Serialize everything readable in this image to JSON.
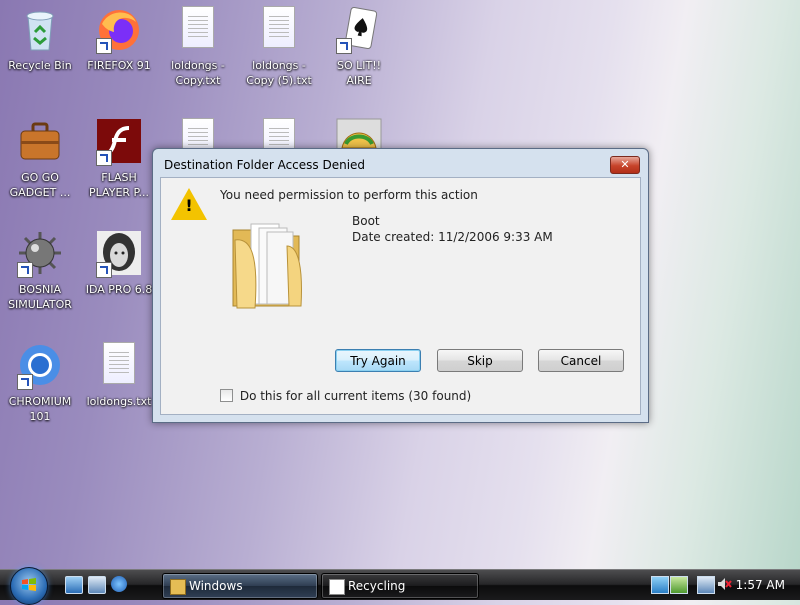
{
  "desktop": {
    "icons": [
      {
        "label": "Recycle Bin",
        "icon": "recycle-bin-icon"
      },
      {
        "label": "FIREFOX 91",
        "icon": "firefox-icon"
      },
      {
        "label": "loldongs - Copy.txt",
        "icon": "text-file-icon"
      },
      {
        "label": "loldongs - Copy (5).txt",
        "icon": "text-file-icon"
      },
      {
        "label": "SO LIT!! AIRE",
        "icon": "solitaire-icon"
      },
      {
        "label": "GO GO GADGET ...",
        "icon": "briefcase-icon"
      },
      {
        "label": "FLASH PLAYER P...",
        "icon": "flash-player-icon"
      },
      {
        "label": "BOSNIA SIMULATOR",
        "icon": "mine-icon"
      },
      {
        "label": "IDA PRO 6.8",
        "icon": "ida-pro-icon"
      },
      {
        "label": "CHROMIUM 101",
        "icon": "chromium-icon"
      },
      {
        "label": "loldongs.txt",
        "icon": "text-file-icon"
      }
    ]
  },
  "dialog": {
    "title": "Destination Folder Access Denied",
    "close_icon": "close-icon",
    "message": "You need permission to perform this action",
    "item_name": "Boot",
    "item_date": "Date created: 11/2/2006 9:33 AM",
    "buttons": {
      "try_again": "Try Again",
      "skip": "Skip",
      "cancel": "Cancel"
    },
    "checkbox_label": "Do this for all current items (30 found)",
    "checkbox_checked": false,
    "warning_icon": "warning-icon",
    "folder_icon": "folder-icon"
  },
  "taskbar": {
    "start_icon": "windows-start-icon",
    "tasks": [
      {
        "label": "Windows",
        "icon": "folder-icon"
      },
      {
        "label": "Recycling",
        "icon": "recycle-progress-icon"
      }
    ],
    "clock": "1:57 AM",
    "tray_icons": [
      "network-icon",
      "volume-muted-icon"
    ]
  },
  "colors": {
    "dialog_frame": "#d5e1ee",
    "close_red": "#c7432a",
    "taskbar": "#1a1a1c"
  }
}
